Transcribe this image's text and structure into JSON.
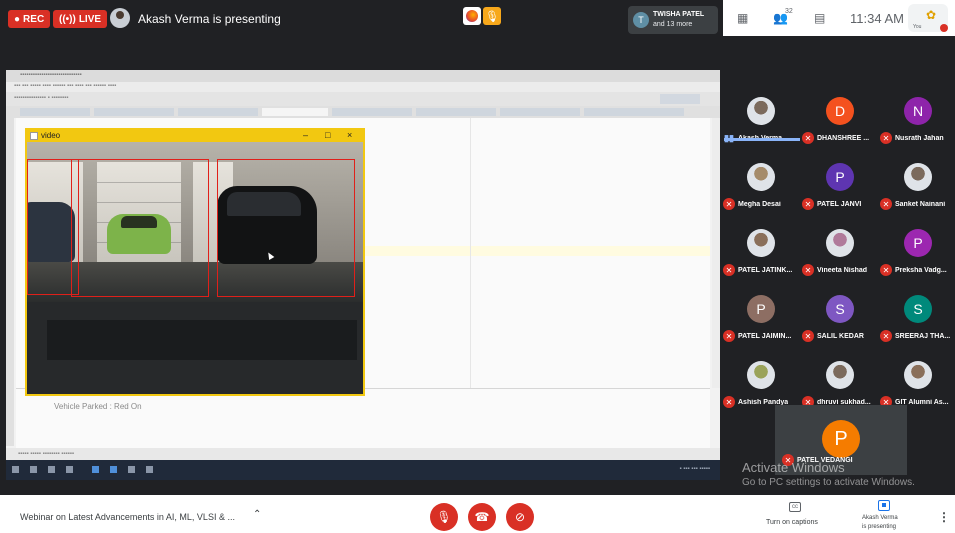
{
  "top_bar": {
    "rec_label": "REC",
    "live_label": "LIVE",
    "presenter_text": "Akash Verma is presenting",
    "participants_name": "TWISHA PATEL",
    "participants_more": "and 13 more",
    "people_count": "32",
    "time": "11:34 AM",
    "you_label": "You",
    "notification_count": "0"
  },
  "shared_screen": {
    "video_window_title": "video",
    "console_text": "Vehicle Parked : Red On",
    "detections": 3
  },
  "participants": [
    {
      "name": "Akash Verma",
      "initial": "",
      "color": "",
      "speaking": true,
      "photo": true
    },
    {
      "name": "DHANSHREE ...",
      "initial": "D",
      "color": "#f4511e",
      "speaking": false,
      "photo": false
    },
    {
      "name": "Nusrath Jahan",
      "initial": "N",
      "color": "#8e24aa",
      "speaking": false,
      "photo": false
    },
    {
      "name": "Megha Desai",
      "initial": "",
      "color": "",
      "speaking": false,
      "photo": true
    },
    {
      "name": "PATEL JANVI",
      "initial": "P",
      "color": "#5e35b1",
      "speaking": false,
      "photo": false
    },
    {
      "name": "Sanket Nainani",
      "initial": "",
      "color": "",
      "speaking": false,
      "photo": true
    },
    {
      "name": "PATEL JATINK...",
      "initial": "",
      "color": "",
      "speaking": false,
      "photo": true
    },
    {
      "name": "Vineeta Nishad",
      "initial": "",
      "color": "",
      "speaking": false,
      "photo": true
    },
    {
      "name": "Preksha Vadg...",
      "initial": "P",
      "color": "#9c27b0",
      "speaking": false,
      "photo": false
    },
    {
      "name": "PATEL JAIMIN...",
      "initial": "P",
      "color": "#8d6e63",
      "speaking": false,
      "photo": false
    },
    {
      "name": "SALIL KEDAR",
      "initial": "S",
      "color": "#7e57c2",
      "speaking": false,
      "photo": false
    },
    {
      "name": "SREERAJ THA...",
      "initial": "S",
      "color": "#00897b",
      "speaking": false,
      "photo": false
    },
    {
      "name": "Ashish Pandya",
      "initial": "",
      "color": "",
      "speaking": false,
      "photo": true
    },
    {
      "name": "dhruvi sukhad...",
      "initial": "",
      "color": "",
      "speaking": false,
      "photo": true
    },
    {
      "name": "GIT Alumni As...",
      "initial": "",
      "color": "",
      "speaking": false,
      "photo": true
    }
  ],
  "featured": {
    "name": "PATEL VEDANGI",
    "initial": "P",
    "color": "#f57c00"
  },
  "watermark": {
    "line1": "Activate Windows",
    "line2": "Go to PC settings to activate Windows."
  },
  "bottom_bar": {
    "meeting_title": "Webinar on Latest Advancements in AI, ML, VLSI & ...",
    "captions_label": "Turn on captions",
    "presenting_line1": "Akash Verma",
    "presenting_line2": "is presenting"
  },
  "icons": {
    "mic": "mic-off-icon",
    "hangup": "call-end-icon",
    "camera": "videocam-off-icon"
  }
}
